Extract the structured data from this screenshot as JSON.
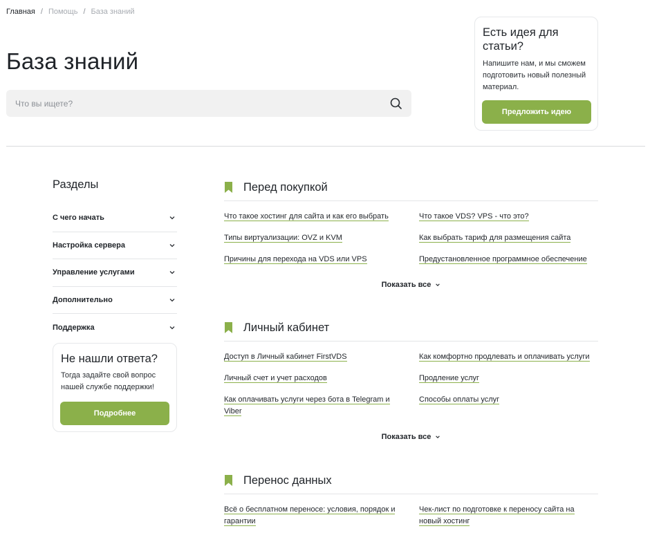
{
  "breadcrumb": {
    "home": "Главная",
    "help": "Помощь",
    "current": "База знаний",
    "separator": "/"
  },
  "page": {
    "title": "База знаний"
  },
  "search": {
    "placeholder": "Что вы ищете?"
  },
  "idea_card": {
    "title": "Есть идея для статьи?",
    "text": "Напишите нам, и мы сможем подготовить новый полезный материал.",
    "button": "Предложить идею"
  },
  "sidebar": {
    "title": "Разделы",
    "items": [
      {
        "label": "С чего начать"
      },
      {
        "label": "Настройка сервера"
      },
      {
        "label": "Управление услугами"
      },
      {
        "label": "Дополнительно"
      },
      {
        "label": "Поддержка"
      }
    ]
  },
  "help_card": {
    "title": "Не нашли ответа?",
    "text": "Тогда задайте свой вопрос нашей службе поддержки!",
    "button": "Подробнее"
  },
  "sections": [
    {
      "title": "Перед покупкой",
      "links": [
        "Что такое хостинг для сайта и как его выбрать",
        "Что такое VDS? VPS - что это?",
        "Типы виртуализации: OVZ и KVM",
        "Как выбрать тариф для размещения сайта",
        "Причины для перехода на VDS или VPS",
        "Предустановленное программное обеспечение"
      ],
      "show_all": "Показать все"
    },
    {
      "title": "Личный кабинет",
      "links": [
        "Доступ в Личный кабинет FirstVDS",
        "Как комфортно продлевать и оплачивать услуги",
        "Личный счет и учет расходов",
        "Продление услуг",
        "Как оплачивать услуги через бота в Telegram и Viber",
        "Способы оплаты услуг"
      ],
      "show_all": "Показать все"
    },
    {
      "title": "Перенос данных",
      "links": [
        "Всё о бесплатном переносе: условия, порядок и гарантии",
        "Чек-лист по подготовке к переносу сайта на новый хостинг"
      ]
    }
  ],
  "colors": {
    "accent": "#8bb04a",
    "text": "#1f2328",
    "search_bg": "#f1f1f1"
  },
  "icons": {
    "search": "search-icon",
    "chevron": "chevron-down-icon",
    "bookmark": "bookmark-icon"
  }
}
